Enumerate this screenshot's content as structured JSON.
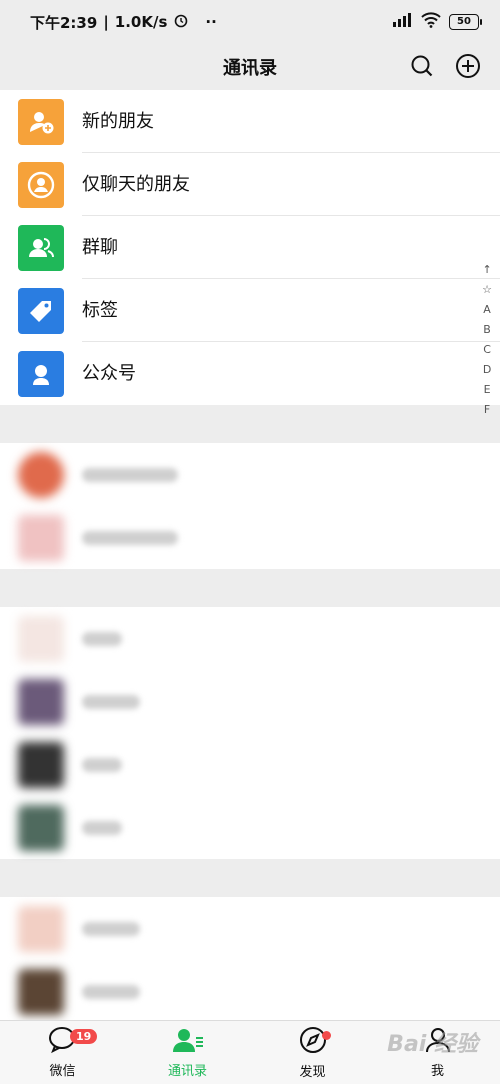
{
  "status": {
    "time": "下午2:39",
    "speed": "1.0K/s",
    "battery": "50"
  },
  "header": {
    "title": "通讯录"
  },
  "features": [
    {
      "label": "新的朋友",
      "icon": "add-friend-icon",
      "color": "#f6a23a"
    },
    {
      "label": "仅聊天的朋友",
      "icon": "chat-friend-icon",
      "color": "#f6a23a"
    },
    {
      "label": "群聊",
      "icon": "group-chat-icon",
      "color": "#1fb859"
    },
    {
      "label": "标签",
      "icon": "tag-icon",
      "color": "#2a7de1"
    },
    {
      "label": "公众号",
      "icon": "official-account-icon",
      "color": "#2a7de1"
    }
  ],
  "index": [
    "↑",
    "☆",
    "A",
    "B",
    "C",
    "D",
    "E",
    "F"
  ],
  "tabs": [
    {
      "label": "微信",
      "badge": "19"
    },
    {
      "label": "通讯录",
      "active": true
    },
    {
      "label": "发现"
    },
    {
      "label": "我"
    }
  ],
  "watermark": "Bai 经验"
}
